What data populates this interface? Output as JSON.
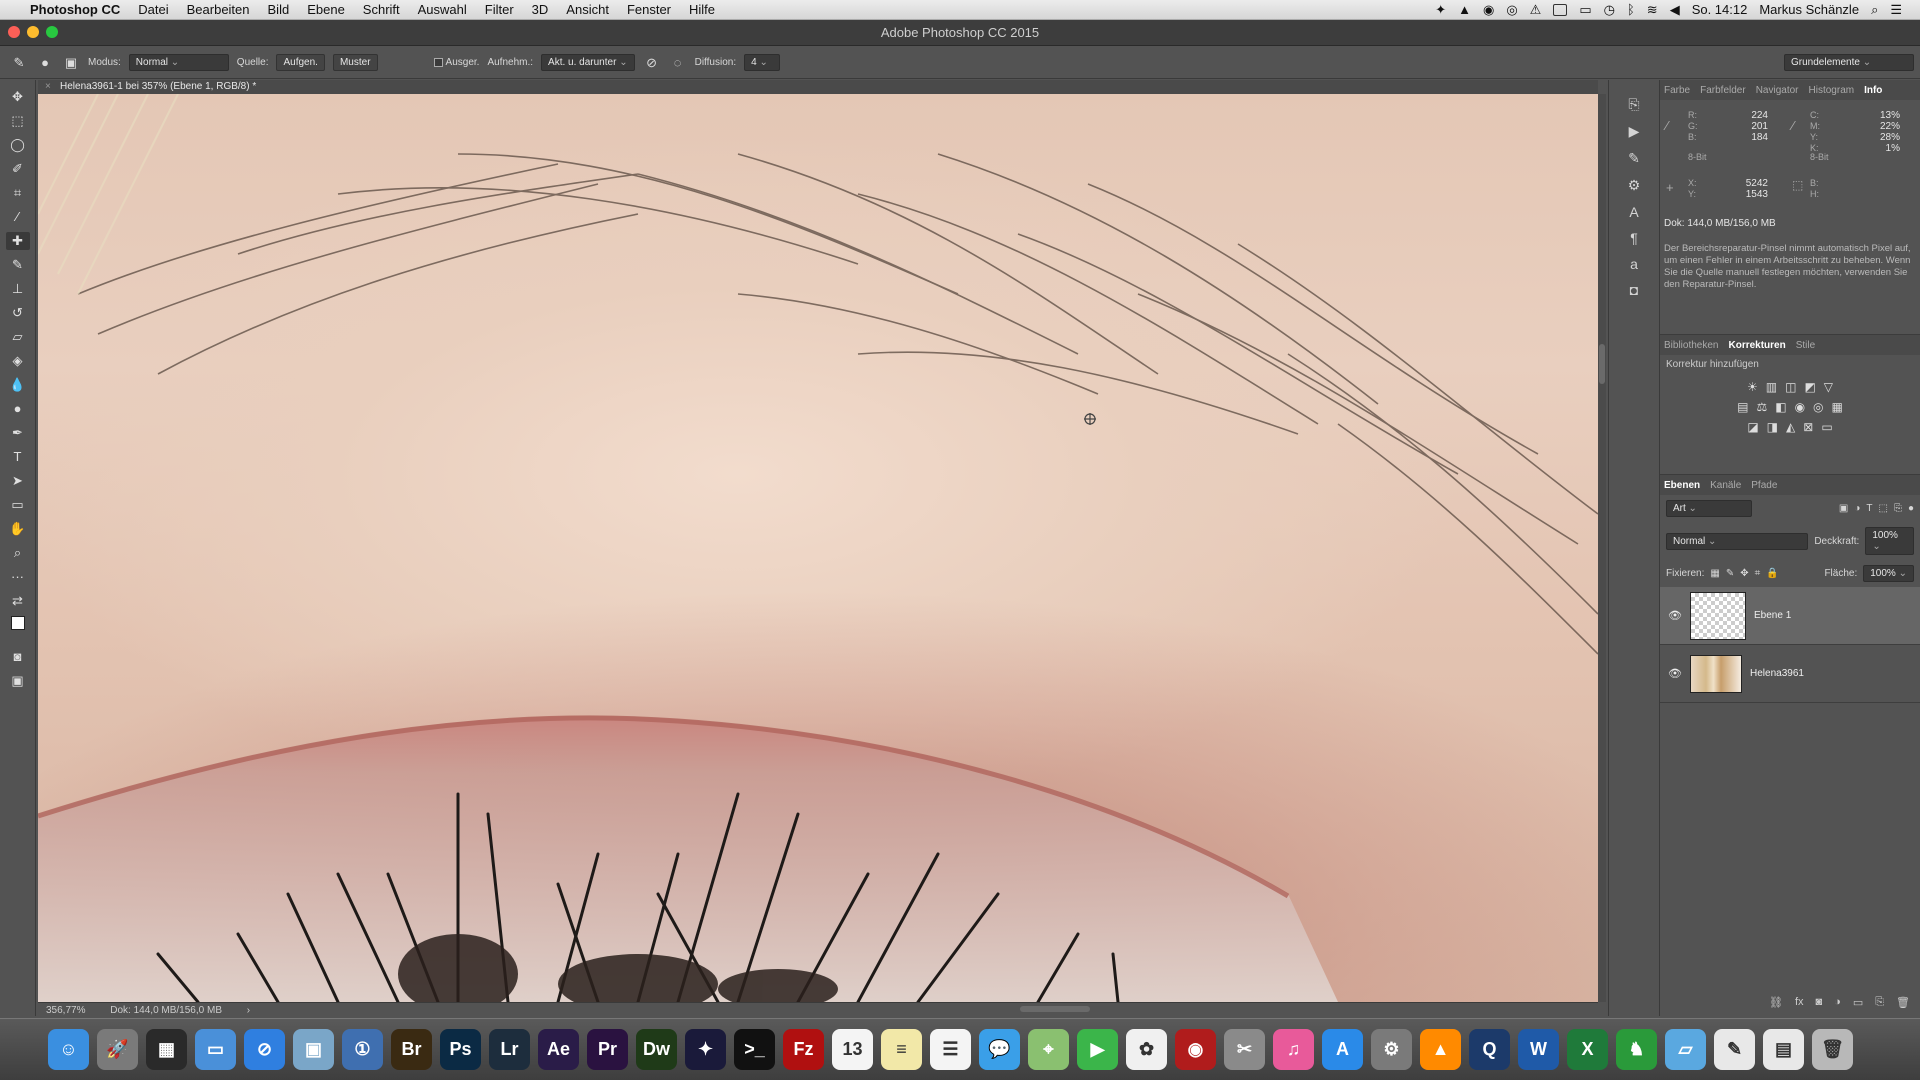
{
  "menubar": {
    "app": "Photoshop CC",
    "items": [
      "Datei",
      "Bearbeiten",
      "Bild",
      "Ebene",
      "Schrift",
      "Auswahl",
      "Filter",
      "3D",
      "Ansicht",
      "Fenster",
      "Hilfe"
    ],
    "clock": "So. 14:12",
    "user": "Markus Schänzle"
  },
  "window": {
    "title": "Adobe Photoshop CC 2015"
  },
  "options": {
    "modus_label": "Modus:",
    "modus_value": "Normal",
    "quelle_label": "Quelle:",
    "aufgen": "Aufgen.",
    "muster": "Muster",
    "ausger": "Ausger.",
    "aufnehm_label": "Aufnehm.:",
    "aufnehm_value": "Akt. u. darunter",
    "diffusion_label": "Diffusion:",
    "diffusion_value": "4",
    "workspace": "Grundelemente"
  },
  "document": {
    "tab": "Helena3961-1 bei 357% (Ebene 1, RGB/8) *",
    "zoom": "356,77%",
    "size": "Dok: 144,0 MB/156,0 MB"
  },
  "info_panel": {
    "tabs": [
      "Farbe",
      "Farbfelder",
      "Navigator",
      "Histogram",
      "Info"
    ],
    "active_tab": "Info",
    "r": "224",
    "g": "201",
    "b": "184",
    "c": "13%",
    "m": "22%",
    "y": "28%",
    "k": "1%",
    "bit1": "8-Bit",
    "bit2": "8-Bit",
    "x": "5242",
    "y_coord": "1543",
    "doc": "Dok: 144,0 MB/156,0 MB",
    "description": "Der Bereichsreparatur-Pinsel nimmt automatisch Pixel auf, um einen Fehler in einem Arbeitsschritt zu beheben. Wenn Sie die Quelle manuell festlegen möchten, verwenden Sie den Reparatur-Pinsel."
  },
  "corrections_panel": {
    "tabs": [
      "Bibliotheken",
      "Korrekturen",
      "Stile"
    ],
    "active_tab": "Korrekturen",
    "header": "Korrektur hinzufügen"
  },
  "layers_panel": {
    "tabs": [
      "Ebenen",
      "Kanäle",
      "Pfade"
    ],
    "active_tab": "Ebenen",
    "filter": "Art",
    "blend": "Normal",
    "opacity_label": "Deckkraft:",
    "opacity": "100%",
    "lock_label": "Fixieren:",
    "fill_label": "Fläche:",
    "fill": "100%",
    "layers": [
      {
        "name": "Ebene 1",
        "selected": true
      },
      {
        "name": "Helena3961",
        "selected": false
      }
    ]
  },
  "dock": {
    "apps": [
      {
        "name": "Finder",
        "glyph": "☺",
        "color": "#3a8fe0"
      },
      {
        "name": "Launchpad",
        "glyph": "🚀",
        "color": "#7a7a7a"
      },
      {
        "name": "Mission Control",
        "glyph": "▦",
        "color": "#2a2a2a"
      },
      {
        "name": "Folder",
        "glyph": "▭",
        "color": "#4a90d9"
      },
      {
        "name": "Safari",
        "glyph": "⊘",
        "color": "#2f7fe0"
      },
      {
        "name": "Preview",
        "glyph": "▣",
        "color": "#7aa6c8"
      },
      {
        "name": "1Password",
        "glyph": "①",
        "color": "#3f6fb0"
      },
      {
        "name": "Bridge",
        "glyph": "Br",
        "color": "#3a2a12"
      },
      {
        "name": "Photoshop",
        "glyph": "Ps",
        "color": "#0b2a44"
      },
      {
        "name": "Lightroom",
        "glyph": "Lr",
        "color": "#1d2d3d"
      },
      {
        "name": "After Effects",
        "glyph": "Ae",
        "color": "#2a1c48"
      },
      {
        "name": "Premiere",
        "glyph": "Pr",
        "color": "#2a1240"
      },
      {
        "name": "Dreamweaver",
        "glyph": "Dw",
        "color": "#1f3a18"
      },
      {
        "name": "iMovie",
        "glyph": "✦",
        "color": "#1a1a3a"
      },
      {
        "name": "Terminal",
        "glyph": ">_",
        "color": "#111"
      },
      {
        "name": "FileZilla",
        "glyph": "Fz",
        "color": "#b01010"
      },
      {
        "name": "Calendar",
        "glyph": "13",
        "color": "#f4f4f4"
      },
      {
        "name": "Notes",
        "glyph": "≡",
        "color": "#f2e8a8"
      },
      {
        "name": "Reminders",
        "glyph": "☰",
        "color": "#f4f4f4"
      },
      {
        "name": "Messages",
        "glyph": "💬",
        "color": "#3a9fe8"
      },
      {
        "name": "Maps",
        "glyph": "⌖",
        "color": "#8ac070"
      },
      {
        "name": "FaceTime",
        "glyph": "▶",
        "color": "#3bb54a"
      },
      {
        "name": "Photos",
        "glyph": "✿",
        "color": "#f0f0f0"
      },
      {
        "name": "Photo Booth",
        "glyph": "◉",
        "color": "#b01c1c"
      },
      {
        "name": "Tools",
        "glyph": "✂",
        "color": "#8a8a8a"
      },
      {
        "name": "iTunes",
        "glyph": "♫",
        "color": "#e85a9a"
      },
      {
        "name": "App Store",
        "glyph": "A",
        "color": "#2a8ae8"
      },
      {
        "name": "System Preferences",
        "glyph": "⚙",
        "color": "#7a7a7a"
      },
      {
        "name": "VLC",
        "glyph": "▲",
        "color": "#ff8a00"
      },
      {
        "name": "QuickTime",
        "glyph": "Q",
        "color": "#1c3a6a"
      },
      {
        "name": "Word",
        "glyph": "W",
        "color": "#1f5aa8"
      },
      {
        "name": "Excel",
        "glyph": "X",
        "color": "#1f7a3a"
      },
      {
        "name": "Evernote",
        "glyph": "♞",
        "color": "#2a9a3a"
      },
      {
        "name": "Applications",
        "glyph": "▱",
        "color": "#5aa8e0"
      },
      {
        "name": "Brushes",
        "glyph": "✎",
        "color": "#e8e8e8"
      },
      {
        "name": "Documents",
        "glyph": "▤",
        "color": "#e8e8e8"
      },
      {
        "name": "Trash",
        "glyph": "🗑",
        "color": "#b8b8b8"
      }
    ]
  }
}
